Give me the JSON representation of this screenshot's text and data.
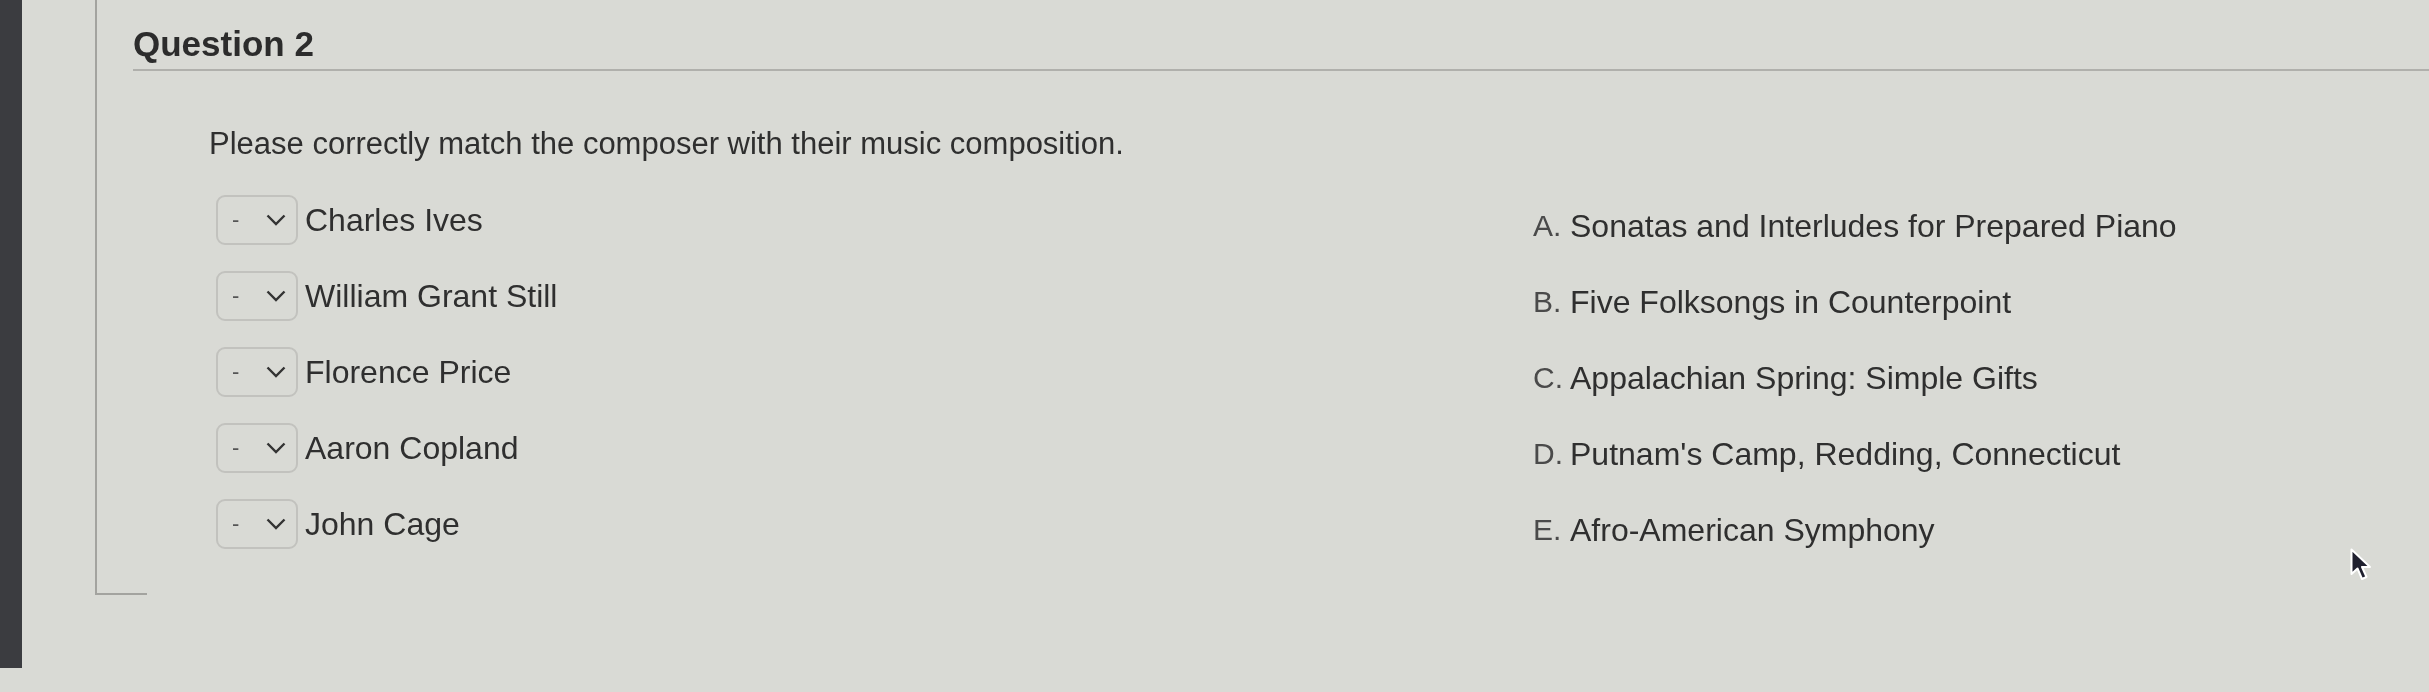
{
  "question": {
    "title": "Question 2",
    "prompt": "Please correctly match the composer with their music composition."
  },
  "matches": [
    {
      "selection": "-",
      "label": "Charles Ives"
    },
    {
      "selection": "-",
      "label": "William Grant Still"
    },
    {
      "selection": "-",
      "label": "Florence Price"
    },
    {
      "selection": "-",
      "label": "Aaron Copland"
    },
    {
      "selection": "-",
      "label": "John Cage"
    }
  ],
  "options": [
    {
      "letter": "A.",
      "text": "Sonatas and Interludes for Prepared Piano"
    },
    {
      "letter": "B.",
      "text": "Five Folksongs in Counterpoint"
    },
    {
      "letter": "C.",
      "text": "Appalachian Spring: Simple Gifts"
    },
    {
      "letter": "D.",
      "text": "Putnam's Camp, Redding, Connecticut"
    },
    {
      "letter": "E.",
      "text": "Afro-American Symphony"
    }
  ]
}
